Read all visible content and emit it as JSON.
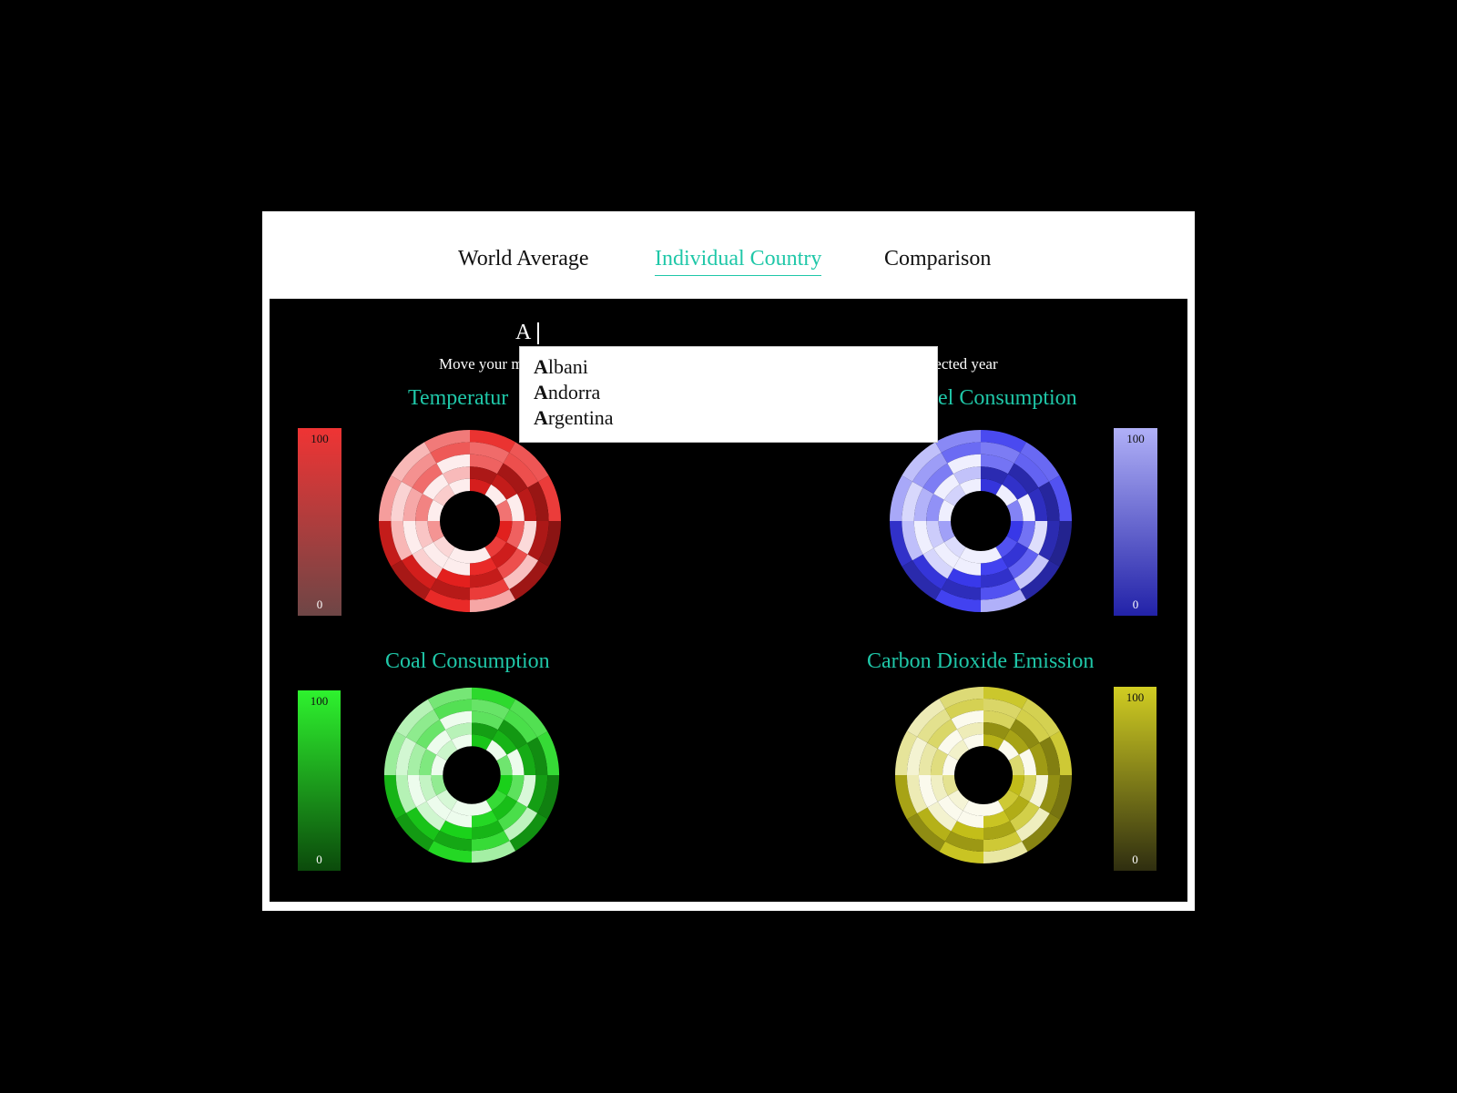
{
  "nav": {
    "world_average": "World Average",
    "individual_country": "Individual Country",
    "comparison": "Comparison"
  },
  "search": {
    "value": "A"
  },
  "instruction": {
    "left_fragment": "Move your m",
    "right_fragment": "elected year"
  },
  "charts": {
    "temperature": {
      "title": "Temperatur",
      "legend_max": "100",
      "legend_min": "0",
      "color": "#e8211f"
    },
    "fuel": {
      "title": "uel Consumption",
      "legend_max": "100",
      "legend_min": "0",
      "color": "#3a3aef"
    },
    "coal": {
      "title": "Coal Consumption",
      "legend_max": "100",
      "legend_min": "0",
      "color": "#1bd61b"
    },
    "co2": {
      "title": "Carbon Dioxide Emission",
      "legend_max": "100",
      "legend_min": "0",
      "color": "#c7c21a"
    }
  },
  "dropdown": {
    "items": [
      {
        "match": "A",
        "rest": "lbani"
      },
      {
        "match": "A",
        "rest": "ndorra"
      },
      {
        "match": "A",
        "rest": "rgentina"
      }
    ]
  },
  "theme": {
    "accent": "#1fc7a8"
  }
}
